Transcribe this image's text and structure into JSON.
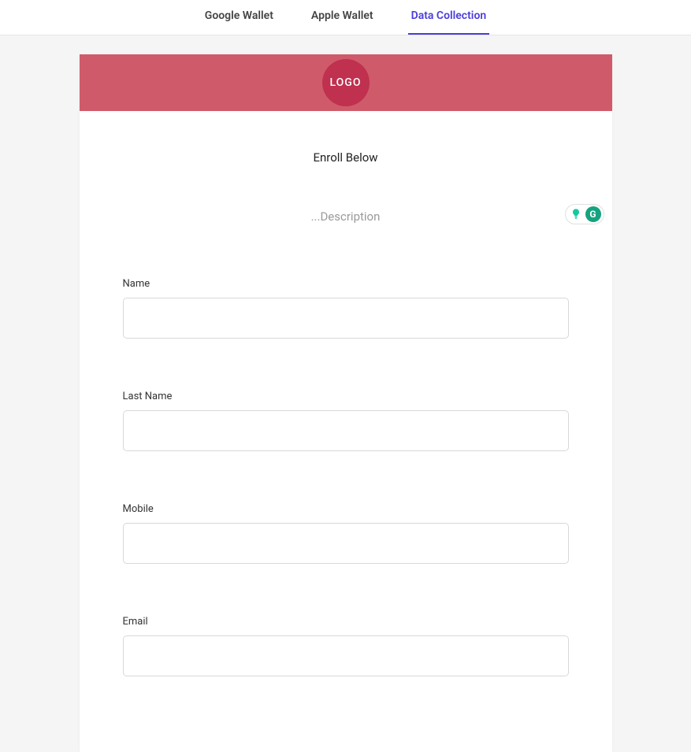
{
  "tabs": [
    {
      "label": "Google Wallet",
      "active": false
    },
    {
      "label": "Apple Wallet",
      "active": false
    },
    {
      "label": "Data Collection",
      "active": true
    }
  ],
  "logo_text": "LOGO",
  "title": "Enroll Below",
  "description": "...Description",
  "grammarly_letter": "G",
  "form_fields": [
    {
      "label": "Name",
      "value": ""
    },
    {
      "label": "Last Name",
      "value": ""
    },
    {
      "label": "Mobile",
      "value": ""
    },
    {
      "label": "Email",
      "value": ""
    }
  ]
}
